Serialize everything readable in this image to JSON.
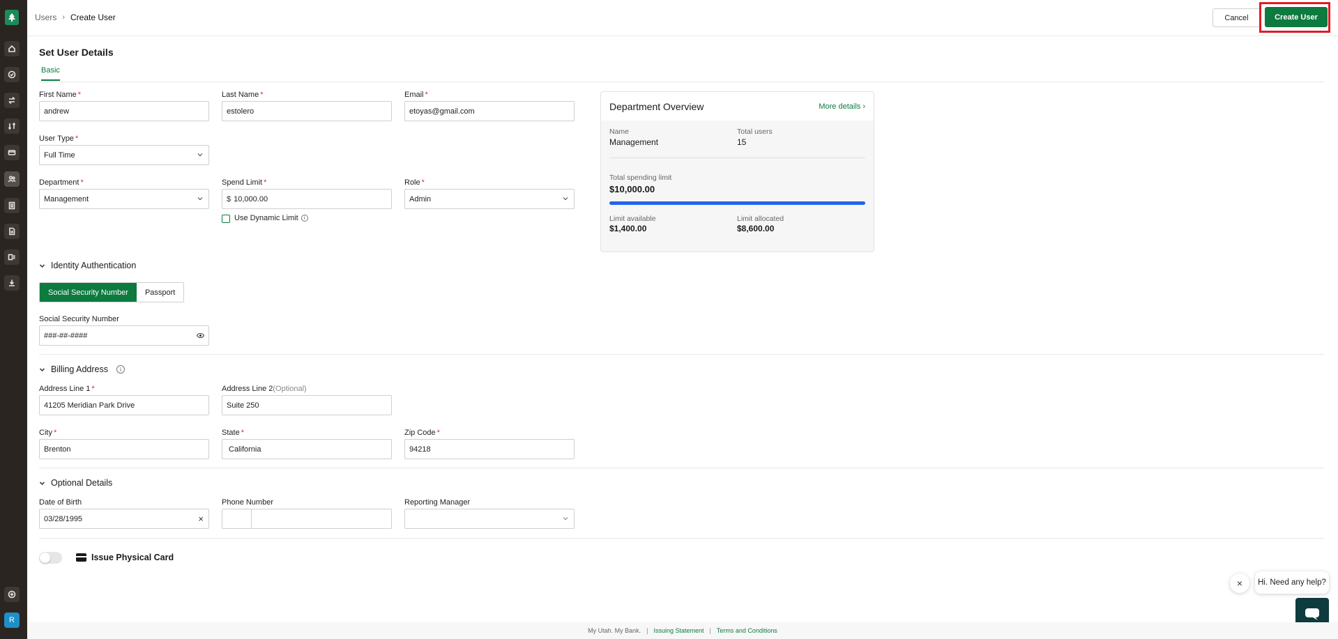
{
  "colors": {
    "accent": "#0d7a3f",
    "sidebar": "#2b2521",
    "highlight": "#e01b24",
    "progress": "#2563eb"
  },
  "sidebar": {
    "logo": "tree-logo-icon",
    "items": [
      "home-icon",
      "check-circle-icon",
      "transfer-icon",
      "swap-icon",
      "card-icon",
      "users-icon",
      "ledger-icon",
      "document-icon",
      "report-icon",
      "download-icon"
    ],
    "bottom_icon": "plus-circle-icon",
    "avatar_initial": "R"
  },
  "header": {
    "breadcrumb": {
      "parent": "Users",
      "separator": "›",
      "current": "Create User"
    },
    "cancel_label": "Cancel",
    "create_label": "Create User"
  },
  "form": {
    "title": "Set User Details",
    "tab_basic": "Basic",
    "first_name": {
      "label": "First Name",
      "value": "andrew"
    },
    "last_name": {
      "label": "Last Name",
      "value": "estolero"
    },
    "email": {
      "label": "Email",
      "value": "etoyas@gmail.com"
    },
    "user_type": {
      "label": "User Type",
      "value": "Full Time"
    },
    "department": {
      "label": "Department",
      "value": "Management"
    },
    "spend_limit": {
      "label": "Spend Limit",
      "currency": "$",
      "value": "10,000.00"
    },
    "role": {
      "label": "Role",
      "value": "Admin"
    },
    "dynamic_limit_label": "Use Dynamic Limit",
    "required_mark": "*"
  },
  "overview": {
    "title": "Department Overview",
    "more_link": "More details ›",
    "name_label": "Name",
    "name_value": "Management",
    "users_label": "Total users",
    "users_value": "15",
    "total_label": "Total spending limit",
    "total_value": "$10,000.00",
    "available_label": "Limit available",
    "available_value": "$1,400.00",
    "allocated_label": "Limit allocated",
    "allocated_value": "$8,600.00",
    "progress_fraction": 1.0
  },
  "identity": {
    "title": "Identity Authentication",
    "option_ssn": "Social Security Number",
    "option_passport": "Passport",
    "ssn_label": "Social Security Number",
    "ssn_value": "###-##-####"
  },
  "billing": {
    "title": "Billing Address",
    "address1": {
      "label": "Address Line 1",
      "value": "41205 Meridian Park Drive"
    },
    "address2": {
      "label": "Address Line 2",
      "optional": "(Optional)",
      "value": "Suite 250"
    },
    "city": {
      "label": "City",
      "value": "Brenton"
    },
    "state": {
      "label": "State",
      "value": "California"
    },
    "zip": {
      "label": "Zip Code",
      "value": "94218"
    }
  },
  "optional": {
    "title": "Optional Details",
    "dob": {
      "label": "Date of Birth",
      "value": "03/28/1995"
    },
    "phone": {
      "label": "Phone Number",
      "value": ""
    },
    "manager": {
      "label": "Reporting Manager",
      "value": ""
    }
  },
  "physical_card": {
    "label": "Issue Physical Card",
    "enabled": false
  },
  "chat": {
    "prompt": "Hi. Need any help?",
    "close": "×"
  },
  "footer": {
    "tagline": "My Utah. My Bank.",
    "separator": "|",
    "link1": "Issuing Statement",
    "link2": "Terms and Conditions"
  }
}
